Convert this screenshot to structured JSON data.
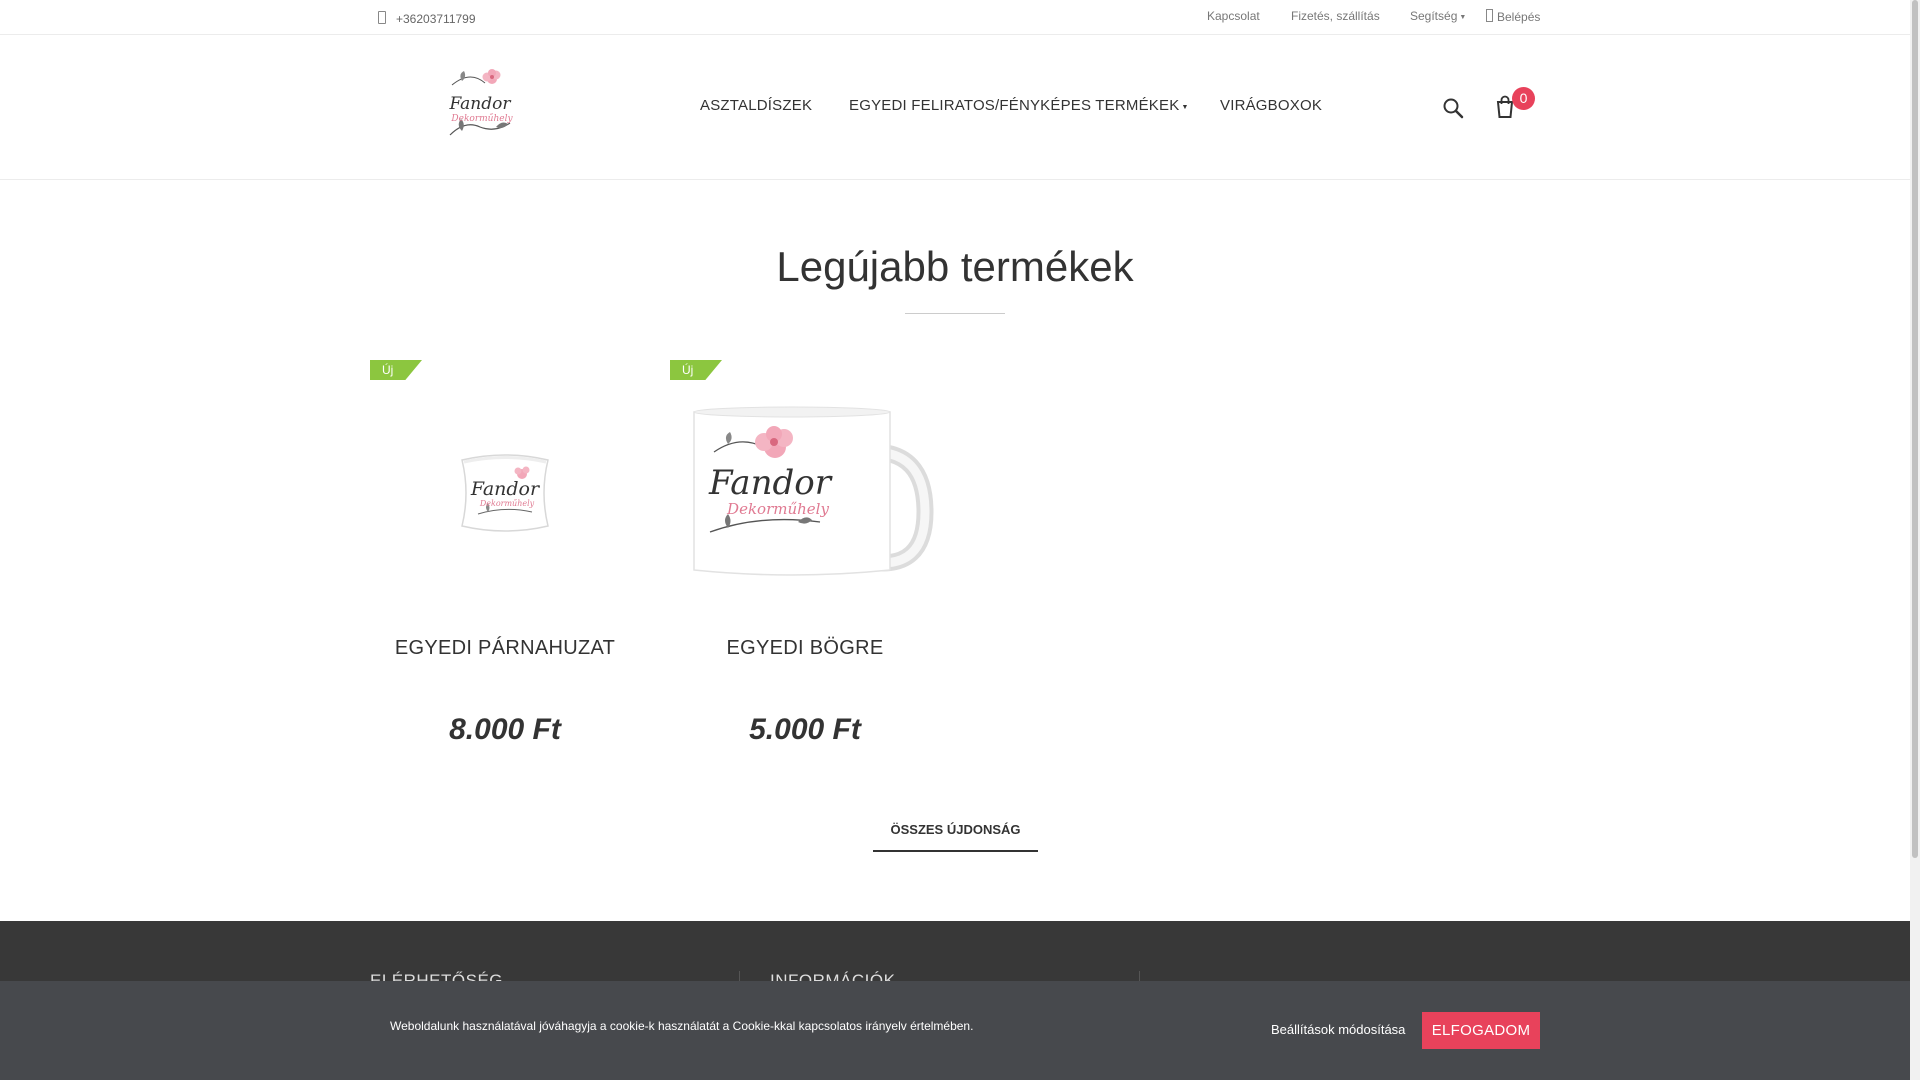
{
  "topbar": {
    "phone": "+36203711799",
    "links": {
      "contact": "Kapcsolat",
      "payment_shipping": "Fizetés, szállítás",
      "help": "Segítség",
      "login": "Belépés"
    }
  },
  "header": {
    "logo_alt": "Fandor Dekorműhely",
    "logo_line1": "Fandor",
    "logo_line2": "Dekorműhely",
    "nav": {
      "item1": "ASZTALDÍSZEK",
      "item2": "EGYEDI FELIRATOS/FÉNYKÉPES TERMÉKEK",
      "item3": "VIRÁGBOXOK"
    },
    "cart_count": "0"
  },
  "section": {
    "title": "Legújabb termékek",
    "all_new_label": "ÖSSZES ÚJDONSÁG"
  },
  "products": [
    {
      "badge": "Új",
      "name": "EGYEDI PÁRNAHUZAT",
      "price": "8.000 Ft"
    },
    {
      "badge": "Új",
      "name": "EGYEDI BÖGRE",
      "price": "5.000 Ft"
    }
  ],
  "footer": {
    "contact_heading": "ELÉRHETŐSÉG",
    "info_heading": "INFORMÁCIÓK"
  },
  "cookie": {
    "text": "Weboldalunk használatával jóváhagyja a cookie-k használatát a Cookie-kkal kapcsolatos irányelv értelmében.",
    "settings_label": "Beállítások módosítása",
    "accept_label": "ELFOGADOM"
  },
  "colors": {
    "accent": "#e8425b",
    "new_badge": "#8cc63f",
    "footer_bg": "#383838",
    "cookie_bg": "#47494d"
  }
}
